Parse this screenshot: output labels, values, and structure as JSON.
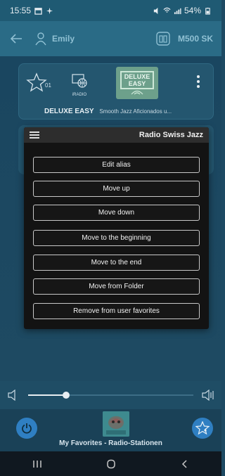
{
  "status_bar": {
    "time": "15:55",
    "battery": "54%"
  },
  "header": {
    "user_name": "Emily",
    "device_name": "M500 SK"
  },
  "station_card": {
    "favorite_number": "01",
    "source_label": "iRADIO",
    "logo_text_line1": "DELUXE",
    "logo_text_line2": "EASY",
    "station_name": "DELUXE EASY",
    "station_description": "Smooth Jazz Aficionados u..."
  },
  "popup": {
    "title": "Radio Swiss Jazz",
    "items": [
      {
        "label": "Edit alias"
      },
      {
        "label": "Move up"
      },
      {
        "label": "Move down"
      },
      {
        "label": "Move to the beginning"
      },
      {
        "label": "Move to the end"
      },
      {
        "label": "Move from Folder"
      },
      {
        "label": "Remove from user favorites"
      }
    ]
  },
  "volume": {
    "level": 0.23
  },
  "player": {
    "title": "My Favorites - Radio-Stationen"
  },
  "colors": {
    "accent": "#2f7fc2",
    "header_bg": "#2a6b86",
    "popup_bg": "#131313"
  }
}
